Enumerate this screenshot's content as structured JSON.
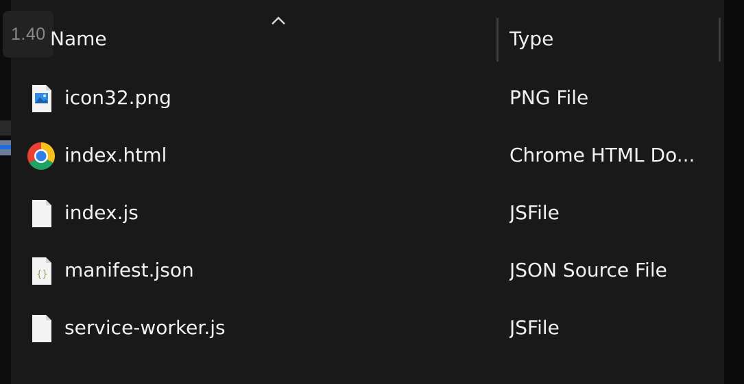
{
  "zoom_badge": "1.40",
  "columns": {
    "name": "Name",
    "type": "Type",
    "sort_direction": "ascending",
    "sort_icon": "chevron-up-icon"
  },
  "files": [
    {
      "name": "icon32.png",
      "type": "PNG File",
      "icon": "png-file-icon"
    },
    {
      "name": "index.html",
      "type": "Chrome HTML Do...",
      "icon": "chrome-icon"
    },
    {
      "name": "index.js",
      "type": "JSFile",
      "icon": "blank-file-icon"
    },
    {
      "name": "manifest.json",
      "type": "JSON Source File",
      "icon": "json-file-icon"
    },
    {
      "name": "service-worker.js",
      "type": "JSFile",
      "icon": "blank-file-icon"
    }
  ],
  "colors": {
    "background": "#191919",
    "text": "#f2f2f2",
    "divider": "#3c3c3c"
  }
}
